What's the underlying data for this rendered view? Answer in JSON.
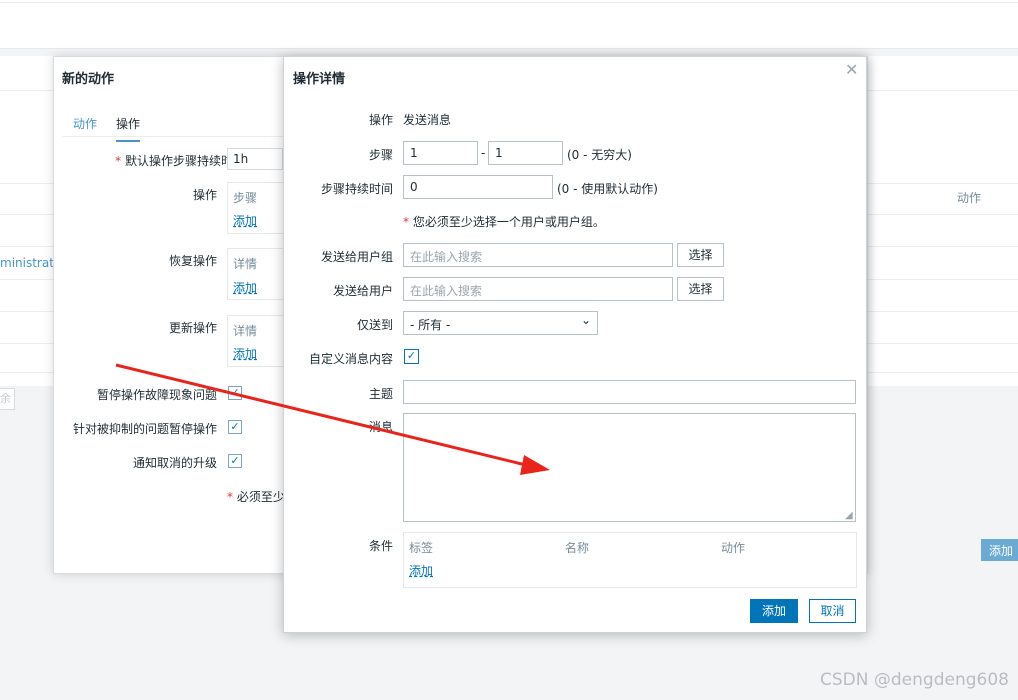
{
  "background": {
    "admin_fragment": "ministrator",
    "action_col": "动作",
    "bg_add_button": "添加",
    "bg_small_btn": "余"
  },
  "modal_bg": {
    "title": "新的动作",
    "tabs": [
      {
        "label": "动作"
      },
      {
        "label": "操作"
      }
    ],
    "default_step_label": "默认操作步骤持续时间",
    "default_step_value": "1h",
    "operations_label": "操作",
    "operations_head": "步骤",
    "recovery_label": "恢复操作",
    "update_label": "更新操作",
    "details_head": "详情",
    "add_link": "添加",
    "pause_label": "暂停操作故障现象问题",
    "suppressed_label": "针对被抑制的问题暂停操作",
    "notify_cancel_label": "通知取消的升级",
    "required_note": "必须至少"
  },
  "modal_op": {
    "title": "操作详情",
    "operation_label": "操作",
    "operation_value": "发送消息",
    "steps_label": "步骤",
    "step_from": "1",
    "step_to": "1",
    "steps_hint": "(0 - 无穷大)",
    "duration_label": "步骤持续时间",
    "duration_value": "0",
    "duration_hint": "(0 - 使用默认动作)",
    "warning": "您必须至少选择一个用户或用户组。",
    "send_groups_label": "发送给用户组",
    "send_users_label": "发送给用户",
    "search_placeholder": "在此输入搜索",
    "select_button": "选择",
    "only_to_label": "仅送到",
    "only_to_value": "- 所有 -",
    "custom_msg_label": "自定义消息内容",
    "custom_msg_checked": true,
    "subject_label": "主题",
    "subject_value": "",
    "message_label": "消息",
    "message_value": "",
    "conditions_label": "条件",
    "cond_headers": [
      "标签",
      "名称",
      "动作"
    ],
    "cond_add_link": "添加",
    "add_button": "添加",
    "cancel_button": "取消"
  },
  "annotation": {
    "arrow_color": "#e8251c"
  },
  "watermark": "CSDN @dengdeng608"
}
